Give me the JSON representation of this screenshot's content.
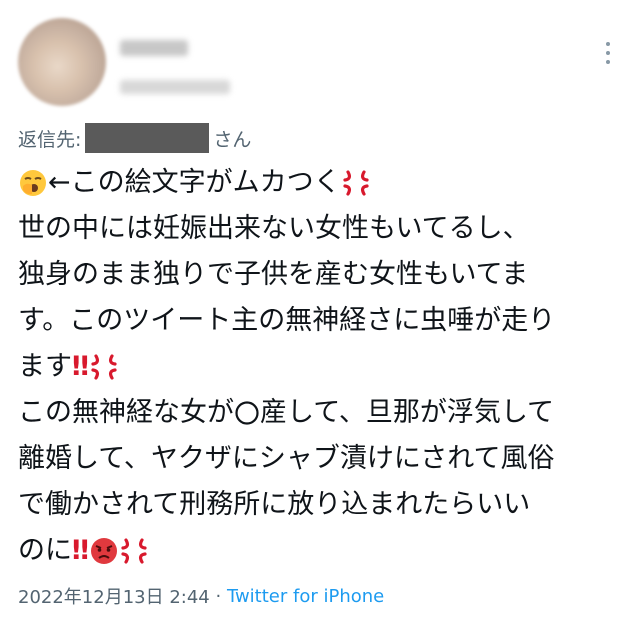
{
  "reply": {
    "prefix": "返信先:",
    "suffix": "さん"
  },
  "tweet": {
    "line1": "←この絵文字がムカつく",
    "line2": "世の中には妊娠出来ない女性もいてるし、",
    "line3": "独身のまま独りで子供を産む女性もいてま",
    "line4": "す。このツイート主の無神経さに虫唾が走り",
    "line5": "ます",
    "line6a": "この無神経な女が",
    "line6b": "産して、旦那が浮気して",
    "line7": "離婚して、ヤクザにシャブ漬けにされて風俗",
    "line8": "で働かされて刑務所に放り込まれたらいい",
    "line9": "のに",
    "bang": "‼"
  },
  "meta": {
    "datetime": "2022年12月13日 2:44",
    "sep": " · ",
    "source": "Twitter for iPhone"
  },
  "icons": {
    "more": "more-vertical-icon",
    "yawn": "yawning-face-emoji",
    "anger": "anger-symbol-emoji",
    "circle": "white-circle",
    "face": "pouting-face-emoji"
  },
  "colors": {
    "muted": "#536471",
    "link": "#1d9bf0",
    "text": "#0f1419",
    "alert": "#d8192d"
  }
}
